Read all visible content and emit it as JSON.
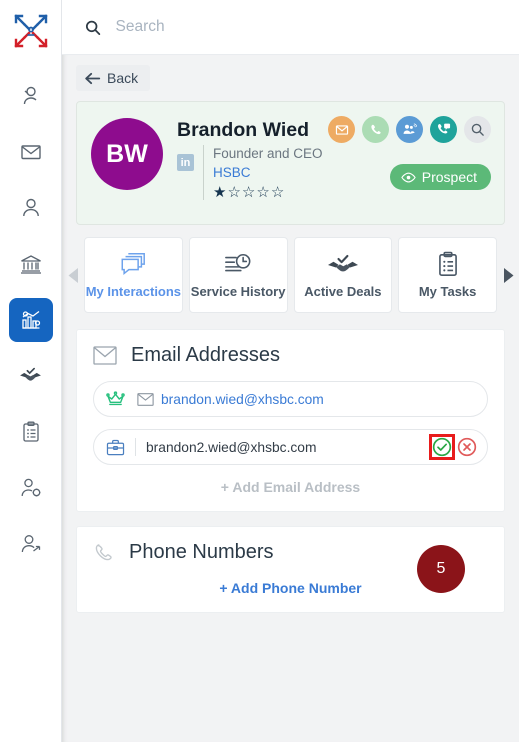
{
  "app": {
    "logo_icon": "crossed-arrows-logo"
  },
  "sidebar": {
    "items": [
      {
        "name": "contacts-search",
        "icon": "person-search-icon",
        "active": false
      },
      {
        "name": "email",
        "icon": "envelope-icon",
        "active": false
      },
      {
        "name": "person",
        "icon": "person-icon",
        "active": false
      },
      {
        "name": "institution",
        "icon": "bank-icon",
        "active": false
      },
      {
        "name": "analytics",
        "icon": "chart-gear-icon",
        "active": true
      },
      {
        "name": "deals",
        "icon": "handshake-check-icon",
        "active": false
      },
      {
        "name": "tasks",
        "icon": "clipboard-list-icon",
        "active": false
      },
      {
        "name": "user-settings",
        "icon": "person-gear-icon",
        "active": false
      },
      {
        "name": "user-transfer",
        "icon": "person-arrow-icon",
        "active": false
      }
    ]
  },
  "search": {
    "placeholder": "Search",
    "value": "",
    "icon": "search-icon"
  },
  "nav": {
    "back_label": "Back",
    "back_icon": "arrow-left-icon"
  },
  "contact": {
    "initials": "BW",
    "name": "Brandon Wied",
    "linkedin_label": "in",
    "role": "Founder and CEO",
    "organization": "HSBC",
    "rating": 1,
    "rating_max": 5,
    "status_label": "Prospect",
    "status_icon": "eye-icon",
    "status_color": "#5cb978",
    "avatar_color": "#8e0c8e",
    "actions": [
      {
        "name": "send-email-action",
        "icon": "envelope-icon",
        "color": "#eeab63"
      },
      {
        "name": "call-action",
        "icon": "phone-icon",
        "color": "#abdcb4"
      },
      {
        "name": "conference-action",
        "icon": "people-call-icon",
        "color": "#5b9bd5"
      },
      {
        "name": "message-call-action",
        "icon": "phone-message-icon",
        "color": "#1fa39b"
      },
      {
        "name": "search-contact-action",
        "icon": "search-icon",
        "color": "#e4e6e9"
      }
    ]
  },
  "tabs": {
    "prev_icon": "chevron-left-icon",
    "next_icon": "chevron-right-icon",
    "items": [
      {
        "label": "My Interactions",
        "icon": "chat-stack-icon",
        "active": true
      },
      {
        "label": "Service History",
        "icon": "clock-lines-icon",
        "active": false
      },
      {
        "label": "Active Deals",
        "icon": "handshake-check-icon",
        "active": false
      },
      {
        "label": "My Tasks",
        "icon": "clipboard-list-icon",
        "active": false
      }
    ]
  },
  "email_section": {
    "title": "Email Addresses",
    "icon": "envelope-icon",
    "rows": [
      {
        "type_icon": "crown-icon",
        "channel_icon": "envelope-icon",
        "value": "brandon.wied@xhsbc.com",
        "editing": false
      },
      {
        "type_icon": "briefcase-icon",
        "value": "brandon2.wied@xhsbc.com",
        "editing": true,
        "confirm_icon": "check-circle-icon",
        "cancel_icon": "x-circle-icon",
        "confirm_color": "#2aa745",
        "cancel_color": "#e05a5a",
        "highlight_color": "#e81c1c"
      }
    ],
    "add_label": "+ Add Email Address"
  },
  "phone_section": {
    "title": "Phone Numbers",
    "icon": "phone-icon",
    "add_label": "+ Add Phone Number"
  },
  "annotation": {
    "step_number": "5",
    "color": "#8b1419"
  }
}
